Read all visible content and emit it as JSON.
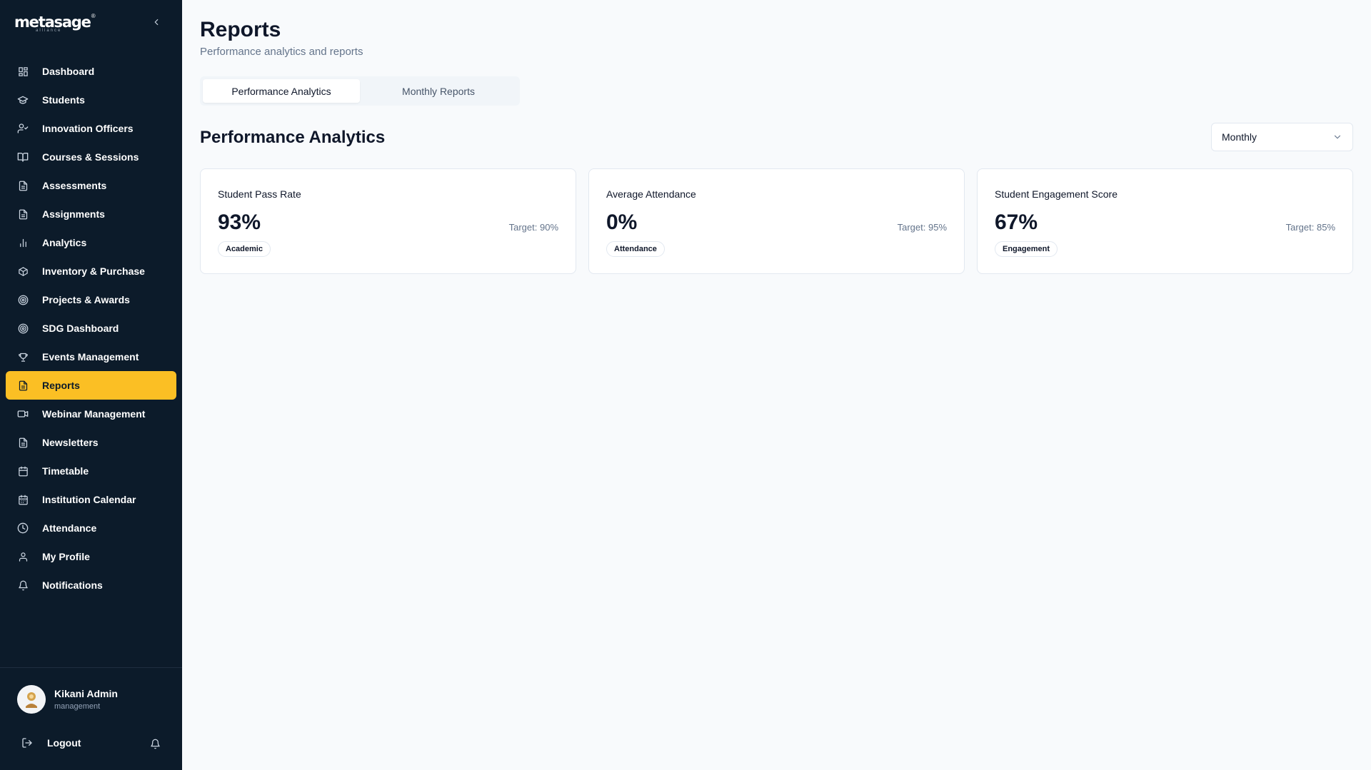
{
  "brand": {
    "name": "metasage",
    "sub": "alliance"
  },
  "sidebar": {
    "items": [
      {
        "label": "Dashboard",
        "icon": "grid-icon"
      },
      {
        "label": "Students",
        "icon": "graduation-cap-icon"
      },
      {
        "label": "Innovation Officers",
        "icon": "user-check-icon"
      },
      {
        "label": "Courses & Sessions",
        "icon": "book-open-icon"
      },
      {
        "label": "Assessments",
        "icon": "file-text-icon"
      },
      {
        "label": "Assignments",
        "icon": "file-text-icon"
      },
      {
        "label": "Analytics",
        "icon": "bar-chart-icon"
      },
      {
        "label": "Inventory & Purchase",
        "icon": "package-icon"
      },
      {
        "label": "Projects & Awards",
        "icon": "target-icon"
      },
      {
        "label": "SDG Dashboard",
        "icon": "target-icon"
      },
      {
        "label": "Events Management",
        "icon": "trophy-icon"
      },
      {
        "label": "Reports",
        "icon": "file-text-icon",
        "active": true
      },
      {
        "label": "Webinar Management",
        "icon": "video-icon"
      },
      {
        "label": "Newsletters",
        "icon": "file-text-icon"
      },
      {
        "label": "Timetable",
        "icon": "calendar-icon"
      },
      {
        "label": "Institution Calendar",
        "icon": "calendar-days-icon"
      },
      {
        "label": "Attendance",
        "icon": "clock-icon"
      },
      {
        "label": "My Profile",
        "icon": "user-icon"
      },
      {
        "label": "Notifications",
        "icon": "bell-icon"
      }
    ]
  },
  "user": {
    "name": "Kikani Admin",
    "role": "management"
  },
  "logout_label": "Logout",
  "header": {
    "title": "Reports",
    "subtitle": "Performance analytics and reports"
  },
  "tabs": [
    {
      "label": "Performance Analytics",
      "active": true
    },
    {
      "label": "Monthly Reports",
      "active": false
    }
  ],
  "section": {
    "title": "Performance Analytics",
    "period_select": "Monthly"
  },
  "cards": [
    {
      "title": "Student Pass Rate",
      "value": "93%",
      "target": "Target: 90%",
      "tag": "Academic"
    },
    {
      "title": "Average Attendance",
      "value": "0%",
      "target": "Target: 95%",
      "tag": "Attendance"
    },
    {
      "title": "Student Engagement Score",
      "value": "67%",
      "target": "Target: 85%",
      "tag": "Engagement"
    }
  ],
  "colors": {
    "sidebar_bg": "#0c1b2a",
    "accent": "#fbbf24",
    "page_bg": "#f8fafc"
  }
}
